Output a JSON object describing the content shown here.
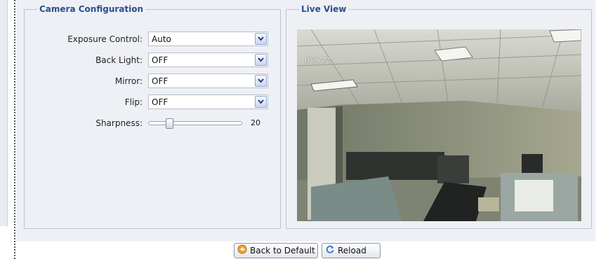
{
  "camera_config": {
    "legend": "Camera Configuration",
    "fields": [
      {
        "label": "Exposure Control:",
        "value": "Auto"
      },
      {
        "label": "Back Light:",
        "value": "OFF"
      },
      {
        "label": "Mirror:",
        "value": "OFF"
      },
      {
        "label": "Flip:",
        "value": "OFF"
      }
    ],
    "sharpness": {
      "label": "Sharpness:",
      "value": "20",
      "level": 0.2
    }
  },
  "live_view": {
    "legend": "Live View",
    "osd_text": "IPCAM"
  },
  "buttons": {
    "back_to_default": "Back to Default",
    "reload": "Reload"
  },
  "icons": {
    "back_to_default": "undo-arrow-icon",
    "reload": "refresh-icon",
    "dropdown": "chevron-down-icon"
  },
  "colors": {
    "legend_text": "#2b4d8f",
    "panel_bg": "#eef0f6",
    "panel_border": "#b9c2d3"
  }
}
